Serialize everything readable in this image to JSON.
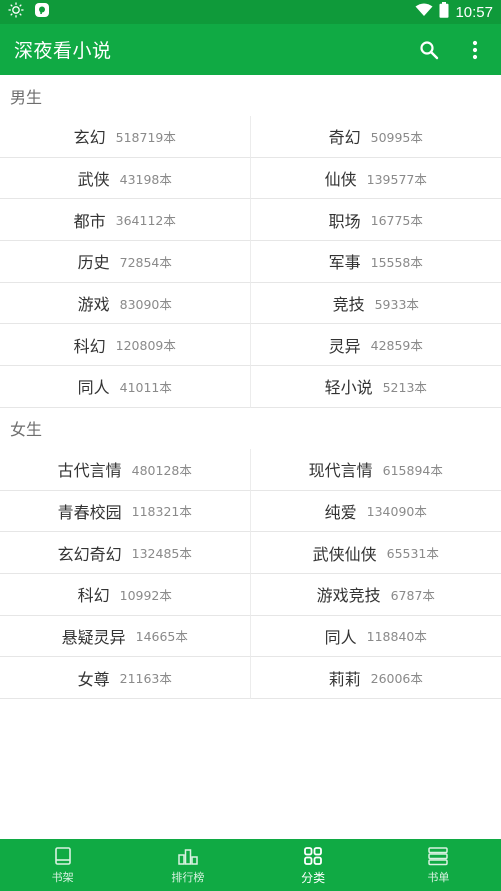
{
  "status_bar": {
    "time": "10:57",
    "icons": [
      "brightness-icon",
      "notification-app-icon",
      "wifi-icon",
      "battery-icon"
    ]
  },
  "app_bar": {
    "title": "深夜看小说",
    "actions": [
      "search-icon",
      "more-vert-icon"
    ],
    "color": "#10aa44"
  },
  "sections": [
    {
      "title": "男生",
      "items": [
        {
          "name": "玄幻",
          "count": "518719本"
        },
        {
          "name": "奇幻",
          "count": "50995本"
        },
        {
          "name": "武侠",
          "count": "43198本"
        },
        {
          "name": "仙侠",
          "count": "139577本"
        },
        {
          "name": "都市",
          "count": "364112本"
        },
        {
          "name": "职场",
          "count": "16775本"
        },
        {
          "name": "历史",
          "count": "72854本"
        },
        {
          "name": "军事",
          "count": "15558本"
        },
        {
          "name": "游戏",
          "count": "83090本"
        },
        {
          "name": "竞技",
          "count": "5933本"
        },
        {
          "name": "科幻",
          "count": "120809本"
        },
        {
          "name": "灵异",
          "count": "42859本"
        },
        {
          "name": "同人",
          "count": "41011本"
        },
        {
          "name": "轻小说",
          "count": "5213本"
        }
      ]
    },
    {
      "title": "女生",
      "items": [
        {
          "name": "古代言情",
          "count": "480128本"
        },
        {
          "name": "现代言情",
          "count": "615894本"
        },
        {
          "name": "青春校园",
          "count": "118321本"
        },
        {
          "name": "纯爱",
          "count": "134090本"
        },
        {
          "name": "玄幻奇幻",
          "count": "132485本"
        },
        {
          "name": "武侠仙侠",
          "count": "65531本"
        },
        {
          "name": "科幻",
          "count": "10992本"
        },
        {
          "name": "游戏竞技",
          "count": "6787本"
        },
        {
          "name": "悬疑灵异",
          "count": "14665本"
        },
        {
          "name": "同人",
          "count": "118840本"
        },
        {
          "name": "女尊",
          "count": "21163本"
        },
        {
          "name": "莉莉",
          "count": "26006本"
        }
      ]
    }
  ],
  "bottom_nav": {
    "items": [
      {
        "label": "书架",
        "icon": "bookshelf-icon",
        "active": false
      },
      {
        "label": "排行榜",
        "icon": "ranking-icon",
        "active": false
      },
      {
        "label": "分类",
        "icon": "category-grid-icon",
        "active": true
      },
      {
        "label": "书单",
        "icon": "booklist-icon",
        "active": false
      }
    ]
  }
}
